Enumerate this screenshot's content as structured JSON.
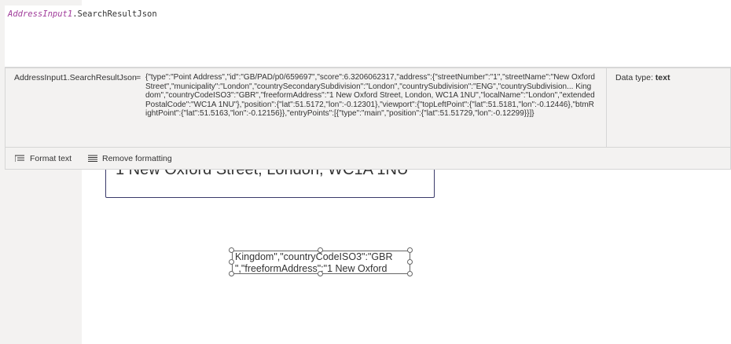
{
  "formula_bar": {
    "control": "AddressInput1",
    "property": ".SearchResultJson"
  },
  "result": {
    "name": "AddressInput1.SearchResultJson",
    "equals": "=",
    "value": "{\"type\":\"Point Address\",\"id\":\"GB/PAD/p0/659697\",\"score\":6.3206062317,\"address\":{\"streetNumber\":\"1\",\"streetName\":\"New Oxford Street\",\"municipality\":\"London\",\"countrySecondarySubdivision\":\"London\",\"countrySubdivision\":\"ENG\",\"countrySubdivision... Kingdom\",\"countryCodeISO3\":\"GBR\",\"freeformAddress\":\"1 New Oxford Street, London, WC1A 1NU\",\"localName\":\"London\",\"extendedPostalCode\":\"WC1A 1NU\"},\"position\":{\"lat\":51.5172,\"lon\":-0.12301},\"viewport\":{\"topLeftPoint\":{\"lat\":51.5181,\"lon\":-0.12446},\"btmRightPoint\":{\"lat\":51.5163,\"lon\":-0.12156}},\"entryPoints\":[{\"type\":\"main\",\"position\":{\"lat\":51.51729,\"lon\":-0.12299}}]}",
    "datatype_label": "Data type:",
    "datatype_value": "text"
  },
  "toolbar": {
    "format_text": "Format text",
    "remove_formatting": "Remove formatting"
  },
  "canvas": {
    "address_value": "1 New Oxford Street, London, WC1A 1NU",
    "label_text": "Kingdom\",\"countryCodeISO3\":\"GBR\n\",\"freeformAddress\":\"1 New Oxford"
  },
  "colors": {
    "control_name": "#a03b9a",
    "panel_bg": "#f3f2f1",
    "input_border": "#3a3a6a"
  },
  "icons": [
    "format-text-icon",
    "remove-formatting-icon"
  ]
}
